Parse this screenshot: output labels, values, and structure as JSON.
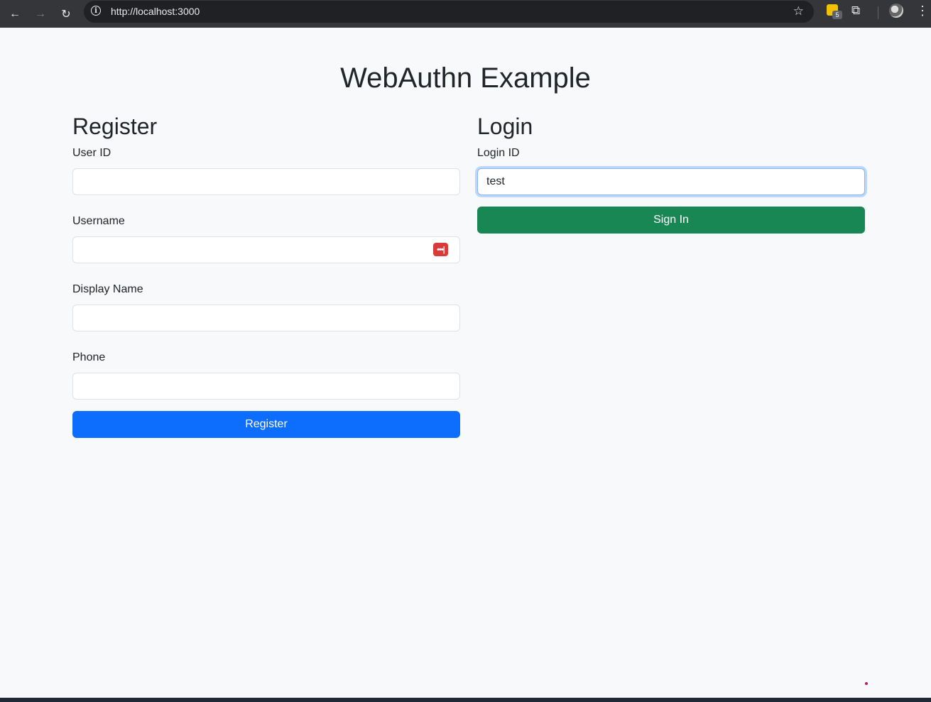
{
  "browser": {
    "url": "http://localhost:3000",
    "extension_badge": "5",
    "back_icon": "←",
    "forward_icon": "→",
    "reload_icon": "↻",
    "info_icon": "i",
    "star_icon": "☆",
    "puzzle_icon": "⧉",
    "menu_icon": "⋮"
  },
  "page": {
    "title": "WebAuthn Example"
  },
  "register": {
    "heading": "Register",
    "user_id_label": "User ID",
    "user_id_value": "",
    "username_label": "Username",
    "username_value": "",
    "display_name_label": "Display Name",
    "display_name_value": "",
    "phone_label": "Phone",
    "phone_value": "",
    "password_manager_icon": "•••|",
    "submit_label": "Register"
  },
  "login": {
    "heading": "Login",
    "login_id_label": "Login ID",
    "login_id_value": "test",
    "submit_label": "Sign In"
  },
  "colors": {
    "primary": "#0d6efd",
    "success": "#198754",
    "background": "#f8f9fa",
    "browser_chrome": "#35363a"
  }
}
